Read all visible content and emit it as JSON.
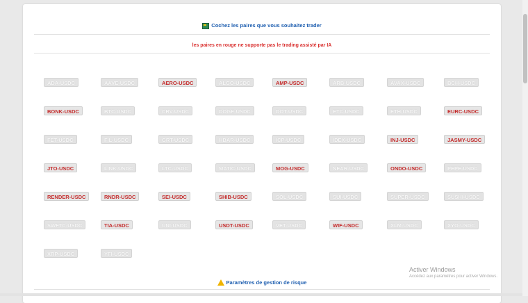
{
  "header": {
    "title": "Cochez les paires que vous souhaitez trader",
    "warning": "les paires en rouge ne supporte pas le trading assisté par IA"
  },
  "pairs": [
    {
      "label": "ADA-USDC",
      "unsupported": false
    },
    {
      "label": "AAVE-USDC",
      "unsupported": false
    },
    {
      "label": "AERO-USDC",
      "unsupported": true
    },
    {
      "label": "ALGO-USDC",
      "unsupported": false
    },
    {
      "label": "AMP-USDC",
      "unsupported": true
    },
    {
      "label": "ARB-USDC",
      "unsupported": false
    },
    {
      "label": "AVAX-USDC",
      "unsupported": false
    },
    {
      "label": "BCH-USDC",
      "unsupported": false
    },
    {
      "label": "BONK-USDC",
      "unsupported": true
    },
    {
      "label": "BTC-USDC",
      "unsupported": false
    },
    {
      "label": "CRV-USDC",
      "unsupported": false
    },
    {
      "label": "DOGE-USDC",
      "unsupported": false
    },
    {
      "label": "DOT-USDC",
      "unsupported": false
    },
    {
      "label": "ETC-USDC",
      "unsupported": false
    },
    {
      "label": "ETH-USDC",
      "unsupported": false
    },
    {
      "label": "EURC-USDC",
      "unsupported": true
    },
    {
      "label": "FET-USDC",
      "unsupported": false
    },
    {
      "label": "FIL-USDC",
      "unsupported": false
    },
    {
      "label": "GRT-USDC",
      "unsupported": false
    },
    {
      "label": "HBAR-USDC",
      "unsupported": false
    },
    {
      "label": "ICP-USDC",
      "unsupported": false
    },
    {
      "label": "IDEX-USDC",
      "unsupported": false
    },
    {
      "label": "INJ-USDC",
      "unsupported": true
    },
    {
      "label": "JASMY-USDC",
      "unsupported": true
    },
    {
      "label": "JTO-USDC",
      "unsupported": true
    },
    {
      "label": "LINK-USDC",
      "unsupported": false
    },
    {
      "label": "LTC-USDC",
      "unsupported": false
    },
    {
      "label": "MATIC-USDC",
      "unsupported": false
    },
    {
      "label": "MOG-USDC",
      "unsupported": true
    },
    {
      "label": "NEAR-USDC",
      "unsupported": false
    },
    {
      "label": "ONDO-USDC",
      "unsupported": true
    },
    {
      "label": "PEPE-USDC",
      "unsupported": false
    },
    {
      "label": "RENDER-USDC",
      "unsupported": true
    },
    {
      "label": "RNDR-USDC",
      "unsupported": true
    },
    {
      "label": "SEI-USDC",
      "unsupported": true
    },
    {
      "label": "SHIB-USDC",
      "unsupported": true
    },
    {
      "label": "SOL-USDC",
      "unsupported": false
    },
    {
      "label": "SUI-USDC",
      "unsupported": false
    },
    {
      "label": "SUPER-USDC",
      "unsupported": false
    },
    {
      "label": "SUSHI-USDC",
      "unsupported": false
    },
    {
      "label": "SWFTC-USDC",
      "unsupported": false
    },
    {
      "label": "TIA-USDC",
      "unsupported": true
    },
    {
      "label": "UNI-USDC",
      "unsupported": false
    },
    {
      "label": "USDT-USDC",
      "unsupported": true
    },
    {
      "label": "VET-USDC",
      "unsupported": false
    },
    {
      "label": "WIF-USDC",
      "unsupported": true
    },
    {
      "label": "XLM-USDC",
      "unsupported": false
    },
    {
      "label": "XYO-USDC",
      "unsupported": false
    },
    {
      "label": "XRP-USDC",
      "unsupported": false
    },
    {
      "label": "YFI-USDC",
      "unsupported": false
    }
  ],
  "footer": {
    "risk_label": "Paramètres de gestion de risque"
  },
  "watermark": {
    "line1": "Activer Windows",
    "line2": "Accédez aux paramètres pour activer Windows."
  },
  "colors": {
    "link_blue": "#1f5fb0",
    "warning_red": "#d9302f",
    "unsupported_text": "#c42b2b",
    "pill_bg": "#e3e3e3",
    "warning_icon": "#f0b400"
  },
  "icons": {
    "header_icon": "chart-icon",
    "footer_icon": "warning-icon"
  }
}
